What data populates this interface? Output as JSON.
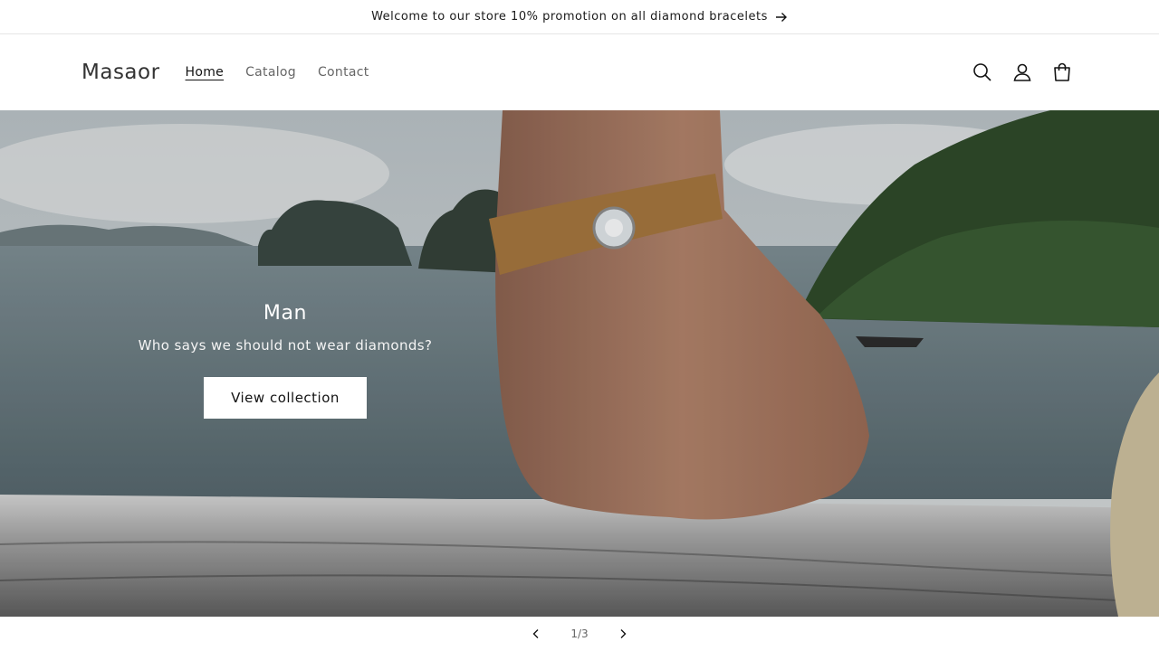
{
  "announcement": {
    "text": "Welcome to our store 10% promotion on all diamond bracelets"
  },
  "header": {
    "logo": "Masaor",
    "nav": [
      {
        "label": "Home",
        "active": true
      },
      {
        "label": "Catalog",
        "active": false
      },
      {
        "label": "Contact",
        "active": false
      }
    ],
    "icons": [
      "search-icon",
      "account-icon",
      "cart-icon"
    ]
  },
  "hero": {
    "title": "Man",
    "subtitle": "Who says we should not wear diamonds?",
    "button_label": "View collection"
  },
  "slider": {
    "counter": "1/3",
    "prev_icon": "chevron-left-icon",
    "next_icon": "chevron-right-icon"
  },
  "colors": {
    "accent": "#121212",
    "background": "#ffffff"
  }
}
